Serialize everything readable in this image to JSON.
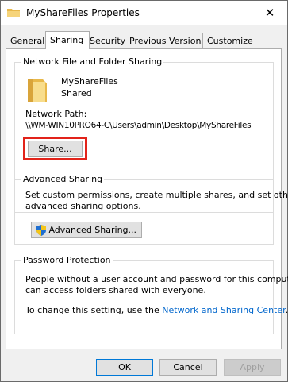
{
  "window": {
    "title": "MyShareFiles Properties",
    "close_glyph": "✕"
  },
  "tabs": [
    {
      "label": "General",
      "active": false
    },
    {
      "label": "Sharing",
      "active": true
    },
    {
      "label": "Security",
      "active": false
    },
    {
      "label": "Previous Versions",
      "active": false
    },
    {
      "label": "Customize",
      "active": false
    }
  ],
  "network_sharing": {
    "group_title": "Network File and Folder Sharing",
    "folder_name": "MyShareFiles",
    "folder_status": "Shared",
    "path_label": "Network Path:",
    "path_value": "\\\\WM-WIN10PRO64-C\\Users\\admin\\Desktop\\MyShareFiles",
    "share_button": "Share..."
  },
  "advanced_sharing": {
    "group_title": "Advanced Sharing",
    "description_line1": "Set custom permissions, create multiple shares, and set other",
    "description_line2": "advanced sharing options.",
    "button": "Advanced Sharing..."
  },
  "password_protection": {
    "group_title": "Password Protection",
    "description_line1": "People without a user account and password for this computer",
    "description_line2": "can access folders shared with everyone.",
    "change_prefix": "To change this setting, use the ",
    "change_link": "Network and Sharing Center",
    "change_suffix": "."
  },
  "footer": {
    "ok": "OK",
    "cancel": "Cancel",
    "apply": "Apply"
  },
  "colors": {
    "highlight": "#e2231a",
    "link": "#0066cc",
    "accent": "#0078d7"
  },
  "icons": [
    "folder-icon",
    "close-icon",
    "uac-shield-icon"
  ]
}
